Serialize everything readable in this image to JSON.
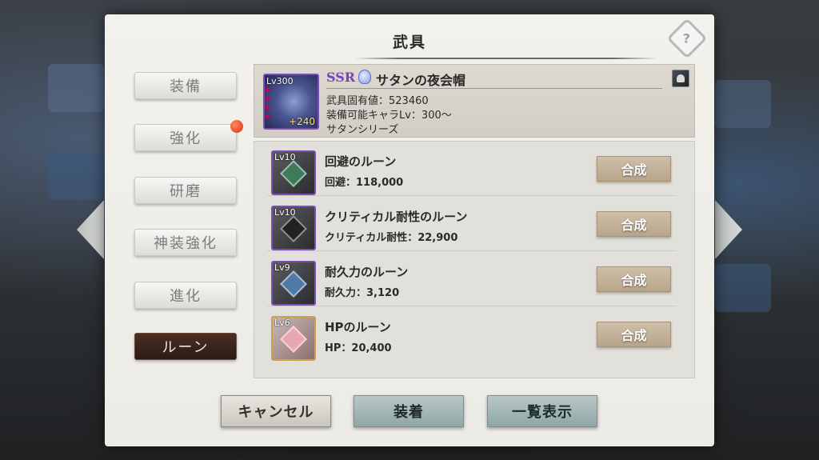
{
  "panel": {
    "title": "武具",
    "help_icon": "?"
  },
  "tabs": [
    {
      "label": "装備",
      "active": false,
      "badge": false
    },
    {
      "label": "強化",
      "active": false,
      "badge": true
    },
    {
      "label": "研磨",
      "active": false,
      "badge": false
    },
    {
      "label": "神装強化",
      "active": false,
      "badge": false
    },
    {
      "label": "進化",
      "active": false,
      "badge": false
    },
    {
      "label": "ルーン",
      "active": true,
      "badge": false
    }
  ],
  "item": {
    "level": "Lv300",
    "plus": "+240",
    "rarity": "SSR",
    "name": "サタンの夜会帽",
    "value_line": "武具固有値：523460",
    "equip_line": "装備可能キャラLv：300〜",
    "series_line": "サタンシリーズ",
    "rarity_color": "#7b3fbf"
  },
  "runes": [
    {
      "level": "Lv10",
      "name": "回避のルーン",
      "stat": "回避：118,000",
      "button": "合成",
      "icon": "green-rune-icon"
    },
    {
      "level": "Lv10",
      "name": "クリティカル耐性のルーン",
      "stat": "クリティカル耐性：22,900",
      "button": "合成",
      "icon": "dark-rune-icon"
    },
    {
      "level": "Lv9",
      "name": "耐久力のルーン",
      "stat": "耐久力：3,120",
      "button": "合成",
      "icon": "blue-rune-icon"
    },
    {
      "level": "Lv6",
      "name": "HPのルーン",
      "stat": "HP：20,400",
      "button": "合成",
      "icon": "heart-rune-icon"
    }
  ],
  "footer": {
    "cancel": "キャンセル",
    "equip": "装着",
    "list": "一覧表示"
  }
}
